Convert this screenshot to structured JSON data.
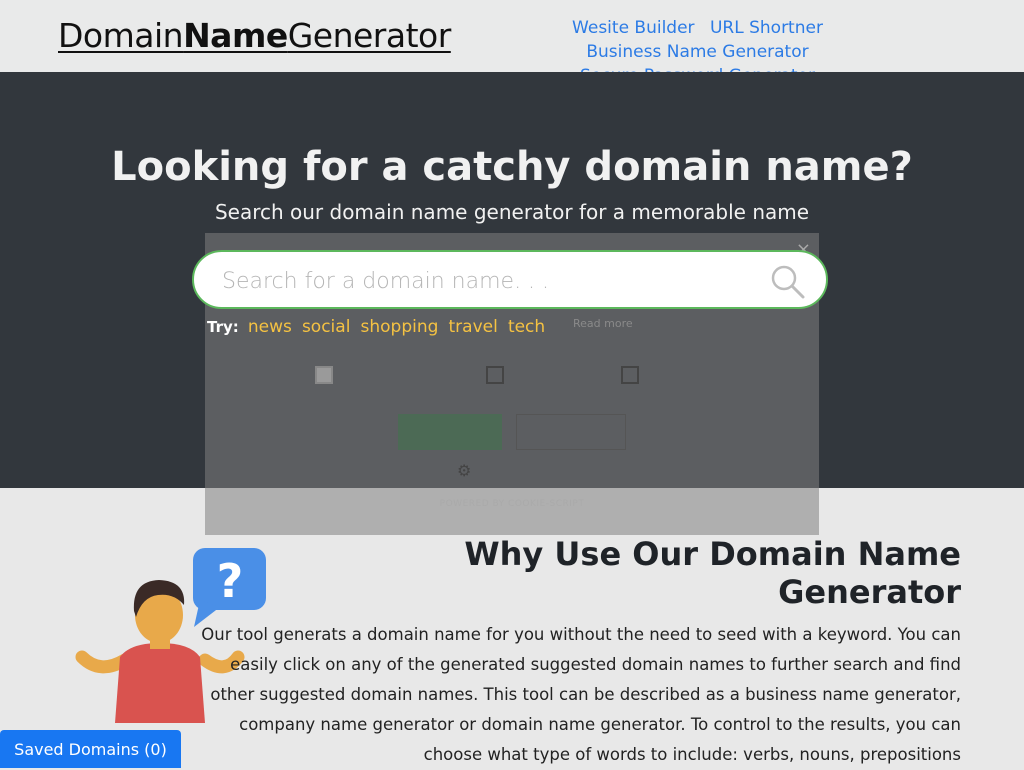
{
  "header": {
    "logo_part1": "Domain",
    "logo_part2": "Name",
    "logo_part3": "Generator",
    "nav": [
      {
        "label": "Wesite Builder"
      },
      {
        "label": "URL Shortner"
      },
      {
        "label": "Business Name Generator"
      },
      {
        "label": "Secure Password Generator"
      }
    ]
  },
  "hero": {
    "title": "Looking for a catchy domain name?",
    "subtitle": "Search our domain name generator for a memorable name",
    "search_placeholder": "Search for a domain name. . .",
    "try_label": "Try:",
    "suggestions": [
      "news",
      "social",
      "shopping",
      "travel",
      "tech"
    ]
  },
  "cookie_banner": {
    "close": "×",
    "read_more": "Read more",
    "powered_by": "POWERED BY COOKIE-SCRIPT"
  },
  "why": {
    "title": "Why Use Our Domain Name Generator",
    "body": "Our tool generats a domain name for you without the need to seed with a keyword. You can easily click on any of the generated suggested domain names to further search and find other suggested domain names. This tool can be described as a business name generator, company name generator or domain name generator. To control to the results, you can choose what type of words to include: verbs, nouns, prepositions"
  },
  "saved_domains_label": "Saved Domains (0)",
  "colors": {
    "hero_bg": "#32373d",
    "link": "#2c7be5",
    "suggestion": "#f5c242",
    "search_border": "#5cb85c",
    "saved_button": "#1877f2"
  }
}
